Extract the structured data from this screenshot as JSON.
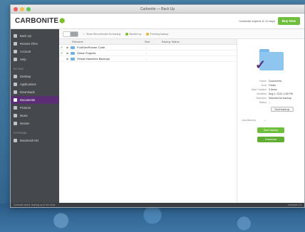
{
  "window": {
    "title": "Carbonite — Back Up"
  },
  "header": {
    "logo_text": "CARBONITE",
    "trial_text": "Carbonite expires in 11 days",
    "buy_label": "Buy Now"
  },
  "sidebar": {
    "top_items": [
      {
        "label": "Back Up"
      },
      {
        "label": "Restore Files"
      },
      {
        "label": "Account"
      },
      {
        "label": "Help"
      }
    ],
    "heading1": "MY MAC",
    "mac_items": [
      {
        "label": "Desktop"
      },
      {
        "label": "Applications"
      },
      {
        "label": "Downloads"
      },
      {
        "label": "Documents",
        "active": true
      },
      {
        "label": "Pictures"
      },
      {
        "label": "Music"
      },
      {
        "label": "Movies"
      }
    ],
    "heading2": "EXTERNAL",
    "ext_items": [
      {
        "label": "Macintosh HD"
      }
    ]
  },
  "toolbar": {
    "link1": "Show files selected for backup",
    "link2": "Backed up",
    "link3": "Pending backup"
  },
  "table": {
    "headers": {
      "name": "Filename",
      "size": "Size",
      "backup": "Backup Status"
    },
    "rows": [
      {
        "check": "✓",
        "name": "FontGeeRunner Code",
        "size": "--"
      },
      {
        "check": "✓",
        "name": "Guitar Projects",
        "size": "--"
      },
      {
        "check": "",
        "name": "Virtual Machines Backups",
        "size": "--"
      }
    ]
  },
  "detail": {
    "fields": [
      {
        "k": "Name",
        "v": "Documents"
      },
      {
        "k": "Kind",
        "v": "Folder"
      },
      {
        "k": "Date Created",
        "v": "3 items"
      },
      {
        "k": "Modified",
        "v": "Aug 2, 2012 1:38 PM"
      },
      {
        "k": "Selection",
        "v": "Selected for backup"
      },
      {
        "k": "Status",
        "v": "--"
      }
    ],
    "dont_label": "Don't back up",
    "last_backup_k": "Last Backup",
    "last_backup_v": "--",
    "btn1": "Start backup",
    "btn2": "Download"
  },
  "statusbar": {
    "left": "Carbonite status: Backing up to the cloud",
    "right": "Carbonite 2.0"
  }
}
